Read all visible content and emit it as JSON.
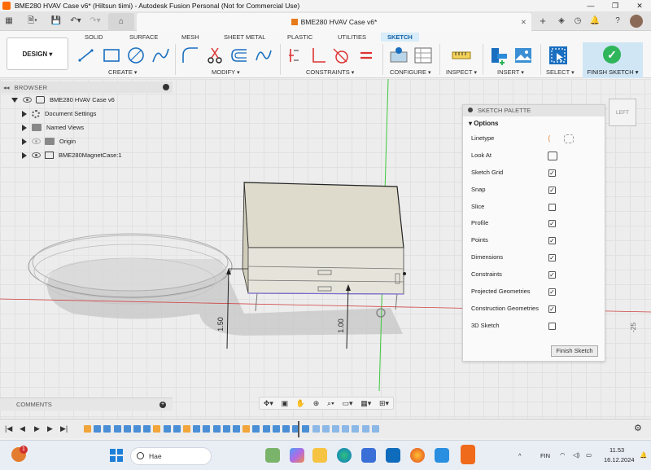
{
  "window": {
    "title": "BME280 HVAV Case v6* (Hiltsun tiimi) - Autodesk Fusion Personal (Not for Commercial Use)",
    "controls": [
      "—",
      "❐",
      "✕"
    ]
  },
  "document_tab": {
    "label": "BME280 HVAV Case v6*"
  },
  "workspace_button": "DESIGN",
  "ribbon_tabs": [
    "SOLID",
    "SURFACE",
    "MESH",
    "SHEET METAL",
    "PLASTIC",
    "UTILITIES",
    "SKETCH"
  ],
  "active_tab": "SKETCH",
  "ribbon_groups": [
    "CREATE",
    "MODIFY",
    "CONSTRAINTS",
    "CONFIGURE",
    "INSPECT",
    "INSERT",
    "SELECT"
  ],
  "finish_sketch_tool": "FINISH SKETCH",
  "browser": {
    "title": "BROWSER",
    "root": "BME280 HVAV Case v6",
    "items": [
      "Document Settings",
      "Named Views",
      "Origin",
      "BME280MagnetCase:1"
    ]
  },
  "sketch_palette": {
    "title": "SKETCH PALETTE",
    "section": "Options",
    "rows": [
      {
        "label": "Linetype",
        "kind": "icons"
      },
      {
        "label": "Look At",
        "kind": "icon"
      },
      {
        "label": "Sketch Grid",
        "kind": "checkbox",
        "checked": true
      },
      {
        "label": "Snap",
        "kind": "checkbox",
        "checked": true
      },
      {
        "label": "Slice",
        "kind": "checkbox",
        "checked": false
      },
      {
        "label": "Profile",
        "kind": "checkbox",
        "checked": true
      },
      {
        "label": "Points",
        "kind": "checkbox",
        "checked": true
      },
      {
        "label": "Dimensions",
        "kind": "checkbox",
        "checked": true
      },
      {
        "label": "Constraints",
        "kind": "checkbox",
        "checked": true
      },
      {
        "label": "Projected Geometries",
        "kind": "checkbox",
        "checked": true
      },
      {
        "label": "Construction Geometries",
        "kind": "checkbox",
        "checked": true
      },
      {
        "label": "3D Sketch",
        "kind": "checkbox",
        "checked": false
      }
    ],
    "finish_button": "Finish Sketch"
  },
  "viewcube": {
    "face": "LEFT"
  },
  "dimensions": {
    "left": "1.50",
    "center": "1.00",
    "right": "-25"
  },
  "comments": {
    "label": "COMMENTS"
  },
  "taskbar": {
    "search_placeholder": "Hae",
    "notification_count": "1",
    "language": "FIN",
    "time": "11.53",
    "date": "16.12.2024"
  },
  "colors": {
    "accent": "#0f5fa6",
    "finish_green": "#2fb55a",
    "axis_green": "#3cc93c",
    "axis_red": "#d04040",
    "body_fill": "#dedbcc"
  }
}
